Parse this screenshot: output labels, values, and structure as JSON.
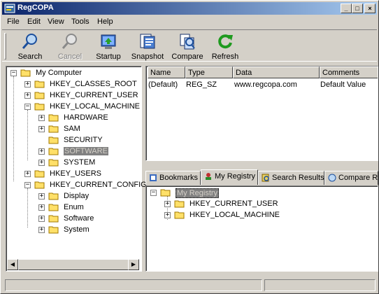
{
  "window": {
    "title": "RegCOPA"
  },
  "title_buttons": {
    "minimize": "_",
    "maximize": "□",
    "close": "×"
  },
  "menu": [
    "File",
    "Edit",
    "View",
    "Tools",
    "Help"
  ],
  "toolbar": {
    "search": "Search",
    "cancel": "Cancel",
    "startup": "Startup",
    "snapshot": "Snapshot",
    "compare": "Compare",
    "refresh": "Refresh"
  },
  "tree": {
    "root": "My Computer",
    "nodes": [
      "HKEY_CLASSES_ROOT",
      "HKEY_CURRENT_USER",
      "HKEY_LOCAL_MACHINE",
      "HARDWARE",
      "SAM",
      "SECURITY",
      "SOFTWARE",
      "SYSTEM",
      "HKEY_USERS",
      "HKEY_CURRENT_CONFIG",
      "Display",
      "Enum",
      "Software",
      "System"
    ],
    "selected": "SOFTWARE"
  },
  "listview": {
    "columns": [
      "Name",
      "Type",
      "Data",
      "Comments"
    ],
    "rows": [
      [
        "(Default)",
        "REG_SZ",
        "www.regcopa.com",
        "Default Value"
      ]
    ]
  },
  "tabs": [
    "Bookmarks",
    "My Registry",
    "Search Results",
    "Compare R"
  ],
  "active_tab": "My Registry",
  "my_registry": {
    "root": "My Registry",
    "children": [
      "HKEY_CURRENT_USER",
      "HKEY_LOCAL_MACHINE"
    ]
  },
  "colors": {
    "titlebar": "#0a246a",
    "face": "#d4d0c8",
    "folder": "#ffe068",
    "selection": "#808080"
  }
}
